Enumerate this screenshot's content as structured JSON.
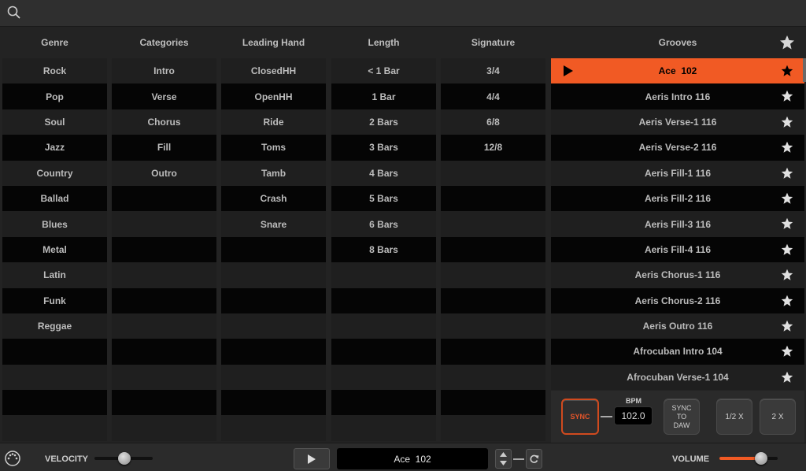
{
  "search": {
    "icon": "search-icon"
  },
  "headers": {
    "genre": "Genre",
    "categories": "Categories",
    "leading_hand": "Leading Hand",
    "length": "Length",
    "signature": "Signature",
    "grooves": "Grooves"
  },
  "genre": [
    "Rock",
    "Pop",
    "Soul",
    "Jazz",
    "Country",
    "Ballad",
    "Blues",
    "Metal",
    "Latin",
    "Funk",
    "Reggae",
    "",
    "",
    "",
    ""
  ],
  "categories": [
    "Intro",
    "Verse",
    "Chorus",
    "Fill",
    "Outro",
    "",
    "",
    "",
    "",
    "",
    "",
    "",
    "",
    "",
    ""
  ],
  "leading_hand": [
    "ClosedHH",
    "OpenHH",
    "Ride",
    "Toms",
    "Tamb",
    "Crash",
    "Snare",
    "",
    "",
    "",
    "",
    "",
    "",
    "",
    ""
  ],
  "length": [
    "< 1 Bar",
    "1 Bar",
    "2 Bars",
    "3 Bars",
    "4 Bars",
    "5 Bars",
    "6 Bars",
    "8 Bars",
    "",
    "",
    "",
    "",
    "",
    "",
    ""
  ],
  "signature": [
    "3/4",
    "4/4",
    "6/8",
    "12/8",
    "",
    "",
    "",
    "",
    "",
    "",
    "",
    "",
    "",
    "",
    ""
  ],
  "grooves": [
    "Ace  102",
    "Aeris Intro 116",
    "Aeris Verse-1 116",
    "Aeris Verse-2 116",
    "Aeris Fill-1 116",
    "Aeris Fill-2 116",
    "Aeris Fill-3 116",
    "Aeris Fill-4 116",
    "Aeris Chorus-1 116",
    "Aeris Chorus-2 116",
    "Aeris Outro 116",
    "Afrocuban Intro 104",
    "Afrocuban Verse-1 104"
  ],
  "selected_groove_index": 0,
  "controls": {
    "sync": "SYNC",
    "bpm_label": "BPM",
    "bpm_value": "102.0",
    "sync_to_daw_1": "SYNC",
    "sync_to_daw_2": "TO",
    "sync_to_daw_3": "DAW",
    "half": "1/2 X",
    "double": "2 X"
  },
  "bottom": {
    "velocity": "VELOCITY",
    "volume": "VOLUME",
    "now_playing": "Ace  102",
    "velocity_level": 0.52,
    "volume_level": 0.72
  },
  "colors": {
    "accent": "#f15a24",
    "bg": "#232323"
  }
}
